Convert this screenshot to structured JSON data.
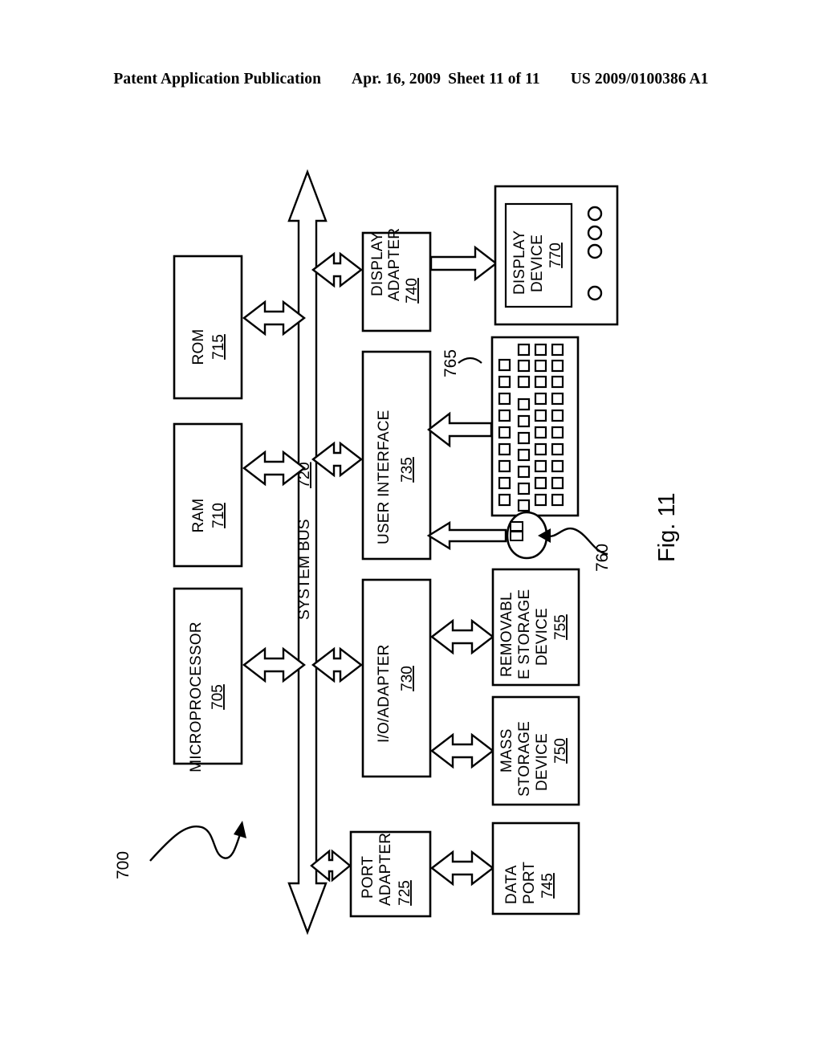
{
  "header": {
    "publication": "Patent Application Publication",
    "date": "Apr. 16, 2009",
    "sheet": "Sheet 11 of 11",
    "number": "US 2009/0100386 A1"
  },
  "figure": {
    "caption": "Fig. 11",
    "system_ref": "700"
  },
  "bus": {
    "label": "SYSTEM BUS",
    "number": "720"
  },
  "blocks": [
    {
      "id": "microprocessor",
      "lines": [
        "MICROPROCESSOR"
      ],
      "number": "705"
    },
    {
      "id": "ram",
      "lines": [
        "RAM"
      ],
      "number": "710"
    },
    {
      "id": "rom",
      "lines": [
        "ROM"
      ],
      "number": "715"
    },
    {
      "id": "port-adapter",
      "lines": [
        "PORT",
        "ADAPTER"
      ],
      "number": "725"
    },
    {
      "id": "io-adapter",
      "lines": [
        "I/O/ADAPTER"
      ],
      "number": "730"
    },
    {
      "id": "user-interface",
      "lines": [
        "USER INTERFACE"
      ],
      "number": "735"
    },
    {
      "id": "display-adapter",
      "lines": [
        "DISPLAY",
        "ADAPTER"
      ],
      "number": "740"
    },
    {
      "id": "data-port",
      "lines": [
        "DATA",
        "PORT"
      ],
      "number": "745"
    },
    {
      "id": "mass-storage-device",
      "lines": [
        "MASS",
        "STORAGE",
        "DEVICE"
      ],
      "number": "750"
    },
    {
      "id": "removable-storage-device",
      "lines": [
        "REMOVABL",
        "E STORAGE",
        "DEVICE"
      ],
      "number": "755"
    },
    {
      "id": "display-device",
      "lines": [
        "DISPLAY",
        "DEVICE"
      ],
      "number": "770"
    }
  ],
  "peripherals": {
    "mouse_ref": "760",
    "keyboard_ref": "765"
  }
}
